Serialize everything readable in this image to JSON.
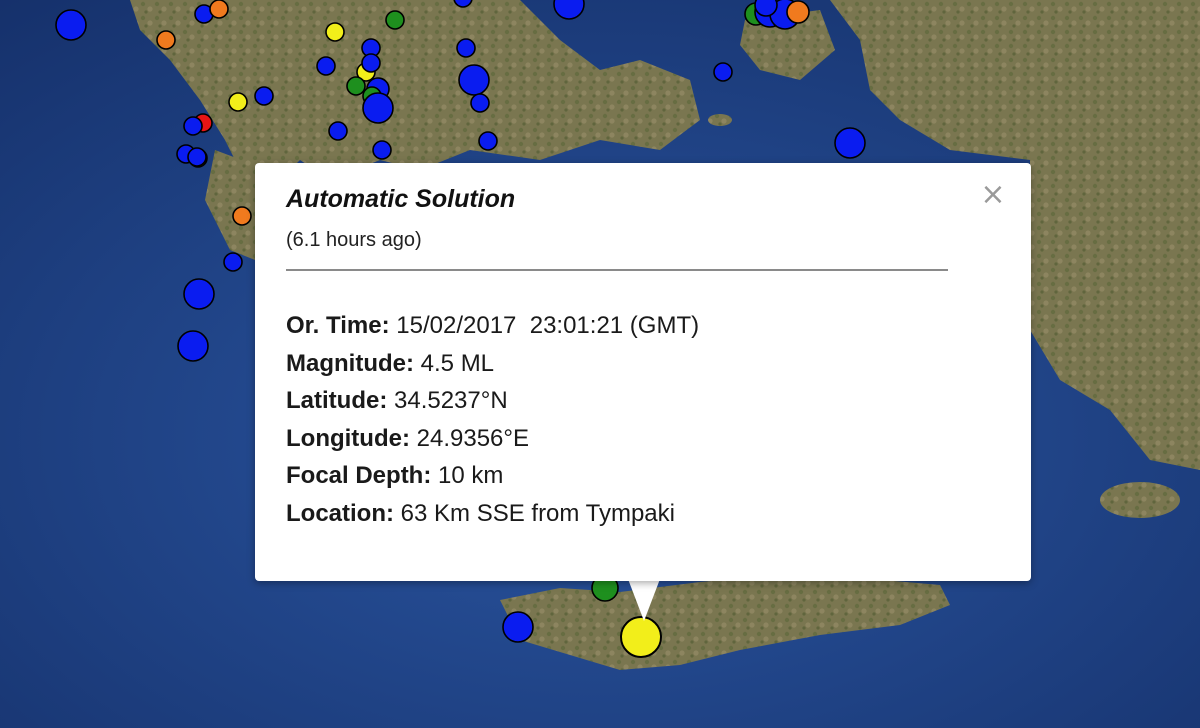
{
  "popup": {
    "title": "Automatic Solution",
    "subtitle": "(6.1 hours ago)",
    "close_symbol": "×",
    "fields": [
      {
        "label": "Or. Time:",
        "value": "15/02/2017  23:01:21 (GMT)"
      },
      {
        "label": "Magnitude:",
        "value": "4.5 ML"
      },
      {
        "label": "Latitude:",
        "value": "34.5237°N"
      },
      {
        "label": "Longitude:",
        "value": "24.9356°E"
      },
      {
        "label": "Focal Depth:",
        "value": "10 km"
      },
      {
        "label": "Location:",
        "value": "63 Km SSE from Tympaki"
      }
    ]
  },
  "map": {
    "sea_color": "#1f3f7a",
    "land_color": "#7d7a55",
    "marker_colors": {
      "blue": "#0a1cf0",
      "green": "#1e8f1e",
      "orange": "#f07a1e",
      "yellow": "#f2ee1a",
      "red": "#e81414"
    },
    "selected_event_color": "#f2ee1a"
  }
}
